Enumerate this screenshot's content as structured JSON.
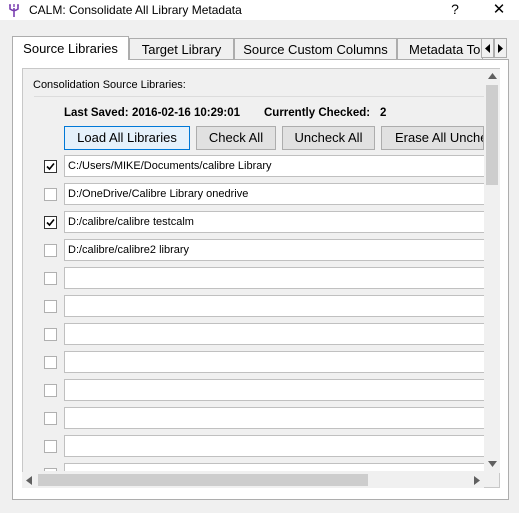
{
  "window": {
    "title": "CALM: Consolidate All Library Metadata",
    "help_label": "?",
    "close_label": "✕"
  },
  "tabs": [
    {
      "label": "Source Libraries"
    },
    {
      "label": "Target Library"
    },
    {
      "label": "Source Custom Columns"
    },
    {
      "label": "Metadata To"
    }
  ],
  "panel": {
    "group_title": "Consolidation Source Libraries:",
    "last_saved_label": "Last Saved:",
    "last_saved_value": "2016-02-16 10:29:01",
    "currently_checked_label": "Currently Checked:",
    "currently_checked_value": "2",
    "buttons": {
      "load_all": "Load All Libraries",
      "check_all": "Check All",
      "uncheck_all": "Uncheck All",
      "erase_all": "Erase All Unche"
    },
    "libraries": [
      {
        "checked": true,
        "path": "C:/Users/MIKE/Documents/calibre Library"
      },
      {
        "checked": false,
        "path": "D:/OneDrive/Calibre Library onedrive"
      },
      {
        "checked": true,
        "path": "D:/calibre/calibre testcalm"
      },
      {
        "checked": false,
        "path": "D:/calibre/calibre2 library"
      },
      {
        "checked": false,
        "path": ""
      },
      {
        "checked": false,
        "path": ""
      },
      {
        "checked": false,
        "path": ""
      },
      {
        "checked": false,
        "path": ""
      },
      {
        "checked": false,
        "path": ""
      },
      {
        "checked": false,
        "path": ""
      },
      {
        "checked": false,
        "path": ""
      },
      {
        "checked": false,
        "path": ""
      }
    ]
  },
  "colors": {
    "accent": "#0078d7",
    "window_bg": "#f0f0f0",
    "button_bg": "#e1e1e1",
    "border": "#adadad"
  }
}
